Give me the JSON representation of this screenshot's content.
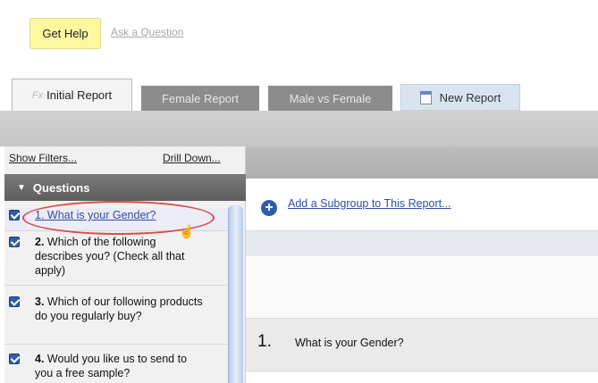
{
  "top": {
    "get_help": "Get Help",
    "ask_question": "Ask a Question"
  },
  "tabs": [
    {
      "icon": "fx-icon",
      "label": "Initial Report",
      "active": true
    },
    {
      "label": "Female Report"
    },
    {
      "label": "Male vs Female"
    },
    {
      "icon": "document-icon",
      "label": "New Report"
    }
  ],
  "left_panel": {
    "show_filters": "Show Filters...",
    "drill_down": "Drill Down...",
    "header": "Questions",
    "questions": [
      {
        "number": "1.",
        "text": "What is your Gender?",
        "checked": true,
        "highlighted": true
      },
      {
        "number": "2.",
        "text": "Which of the following describes you? (Check all that apply)",
        "checked": true
      },
      {
        "number": "3.",
        "text": "Which of our following products do you regularly buy?",
        "checked": true
      },
      {
        "number": "4.",
        "text": "Would you like us to send to you a free sample?",
        "checked": true
      }
    ]
  },
  "main": {
    "add_subgroup": "Add a Subgroup to This Report...",
    "question_number": "1.",
    "question_title": "What is your Gender?"
  },
  "colors": {
    "help_bg": "#fdf7a0",
    "link_blue": "#2d4fa8",
    "annotation_red": "#d94b48",
    "tab_inactive": "#8c8c8c"
  }
}
